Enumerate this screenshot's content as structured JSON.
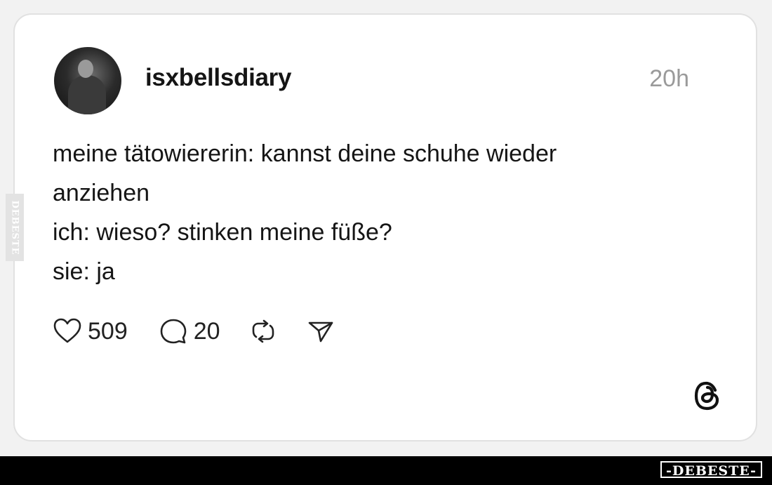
{
  "post": {
    "username": "isxbellsdiary",
    "time": "20h",
    "lines": [
      "meine tätowiererin: kannst deine schuhe wieder",
      "anziehen",
      "ich: wieso? stinken meine füße?",
      "sie: ja"
    ],
    "actions": {
      "likes": "509",
      "replies": "20"
    }
  },
  "icons": {
    "like": "heart-icon",
    "reply": "comment-bubble-icon",
    "repost": "repost-icon",
    "share": "send-icon",
    "platform": "threads-logo-icon"
  },
  "watermark": {
    "side": "DEBESTE",
    "bottom": "-DEBESTE-"
  },
  "colors": {
    "text": "#151515",
    "muted": "#9a9a9a",
    "card_border": "#e1e1e1",
    "bottom_bar": "#000000"
  }
}
